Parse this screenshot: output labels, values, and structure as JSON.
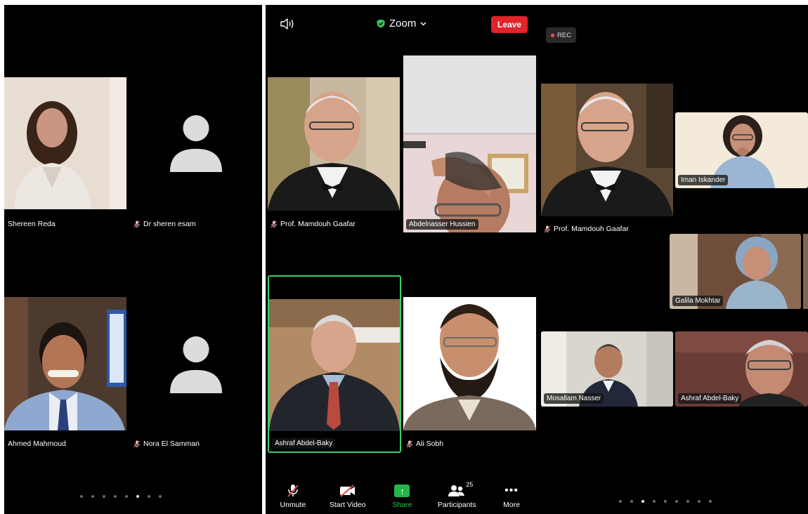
{
  "panel1": {
    "tiles": [
      {
        "name": "Shereen Reda",
        "muted": false
      },
      {
        "name": "Dr sheren esam",
        "muted": true
      },
      {
        "name": "Ahmed Mahmoud",
        "muted": false
      },
      {
        "name": "Nora El Samman",
        "muted": true
      }
    ],
    "page_dots": {
      "count": 8,
      "active": 5
    }
  },
  "panel2": {
    "top_bar": {
      "speaker_icon": "speaker-icon",
      "title": "Zoom",
      "title_icon": "shield-check-icon",
      "leave_label": "Leave",
      "leave_color": "#e0242a"
    },
    "tiles": [
      {
        "name": "Prof. Mamdouh Gaafar",
        "muted": true
      },
      {
        "name": "Abdelnasser Hussien",
        "muted": false
      },
      {
        "name": "Ashraf Abdel-Baky",
        "muted": false,
        "active_speaker": true
      },
      {
        "name": "Ali Sobh",
        "muted": true
      }
    ],
    "toolbar": {
      "unmute_label": "Unmute",
      "start_video_label": "Start Video",
      "share_label": "Share",
      "participants_label": "Participants",
      "participants_count": "25",
      "more_label": "More",
      "share_color": "#23b54a"
    }
  },
  "panel3": {
    "rec_label": "REC",
    "tiles": [
      {
        "name": "Prof. Mamdouh Gaafar",
        "muted": true
      },
      {
        "name": "Iman Iskander"
      },
      {
        "name": "Galila Mokhtar"
      },
      {
        "name": "Mosallam Nasser"
      },
      {
        "name": "Ashraf Abdel-Baky"
      }
    ],
    "page_dots": {
      "count": 9,
      "active": 2
    }
  },
  "colors": {
    "background": "#000000",
    "active_speaker_border": "#3fcf66",
    "muted_mic": "#e04848"
  }
}
